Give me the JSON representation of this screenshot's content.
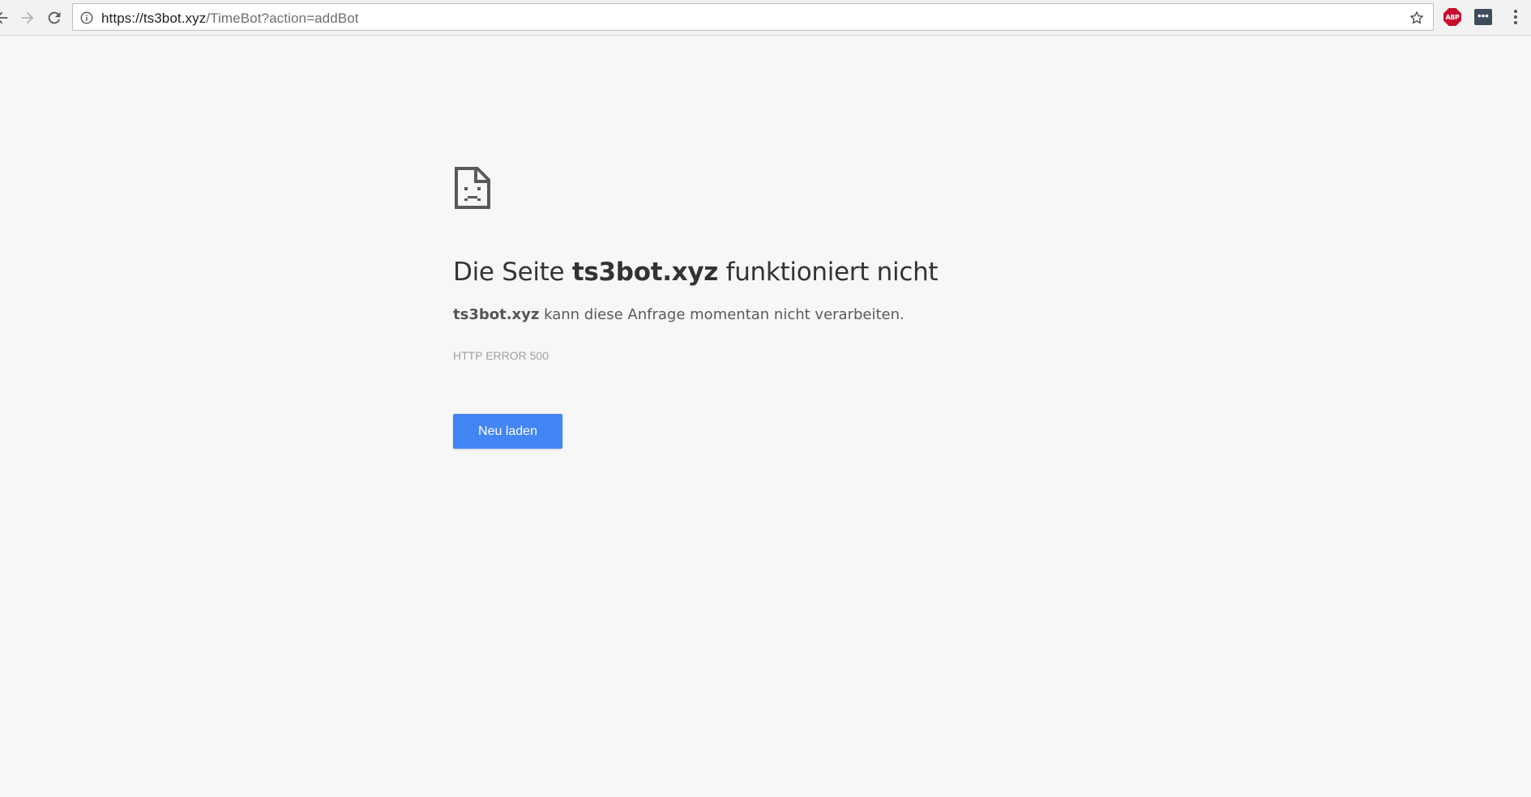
{
  "browser": {
    "url_host": "https://ts3bot.xyz",
    "url_path": "/TimeBot?action=addBot",
    "icons": {
      "back": "arrow-left-icon",
      "forward": "arrow-right-icon",
      "reload": "reload-icon",
      "site_info": "info-icon",
      "bookmark": "star-icon",
      "menu": "kebab-menu-icon"
    },
    "extensions": {
      "adblock_label": "ABP",
      "dark_ext_label": "•••"
    }
  },
  "error_page": {
    "icon": "sad-page-icon",
    "title_prefix": "Die Seite ",
    "title_host": "ts3bot.xyz",
    "title_suffix": " funktioniert nicht",
    "desc_host": "ts3bot.xyz",
    "desc_text": " kann diese Anfrage momentan nicht verarbeiten.",
    "error_code": "HTTP ERROR 500",
    "reload_button": "Neu laden"
  },
  "colors": {
    "page_background": "#f7f7f7",
    "button_blue": "#4285f4",
    "adblock_red": "#c70d2c"
  }
}
